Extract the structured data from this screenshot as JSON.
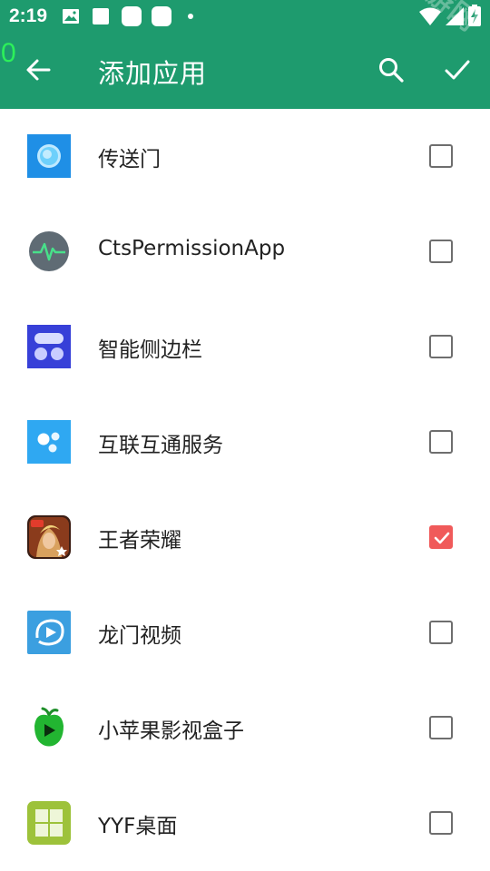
{
  "status_bar": {
    "time": "2:19"
  },
  "debug_overlay": "0",
  "watermark": "新华手游网",
  "toolbar": {
    "title": "添加应用"
  },
  "theme": {
    "accent": "#1e9b6e",
    "check_color": "#f05a5a"
  },
  "apps": [
    {
      "name": "传送门",
      "icon": "portal-app-icon",
      "checked": false
    },
    {
      "name": "CtsPermissionApp",
      "icon": "permission-app-icon",
      "checked": false
    },
    {
      "name": "智能侧边栏",
      "icon": "sidebar-app-icon",
      "checked": false
    },
    {
      "name": "互联互通服务",
      "icon": "interconnect-app-icon",
      "checked": false
    },
    {
      "name": "王者荣耀",
      "icon": "game-app-icon",
      "checked": true
    },
    {
      "name": "龙门视频",
      "icon": "video-app-icon",
      "checked": false
    },
    {
      "name": "小苹果影视盒子",
      "icon": "apple-tv-app-icon",
      "checked": false
    },
    {
      "name": "YYF桌面",
      "icon": "launcher-app-icon",
      "checked": false
    }
  ]
}
